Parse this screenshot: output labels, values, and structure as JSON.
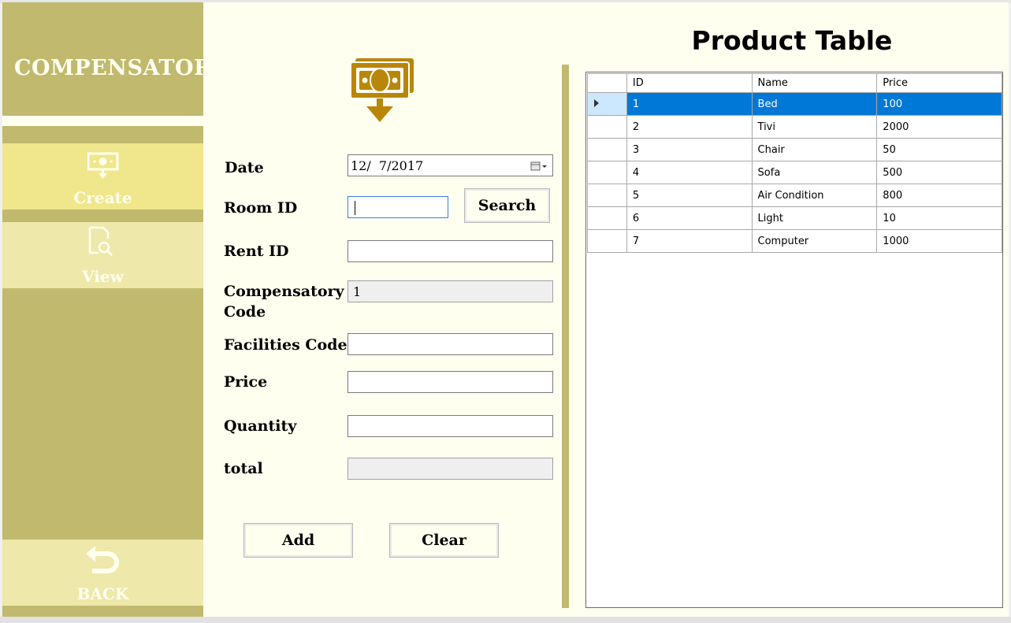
{
  "sidebar": {
    "brand": "COMPENSATORY",
    "items": [
      {
        "label": "Create",
        "icon": "money-icon"
      },
      {
        "label": "View",
        "icon": "document-search-icon"
      }
    ],
    "back": {
      "label": "BACK",
      "icon": "back-arrow-icon"
    }
  },
  "form": {
    "date": {
      "label": "Date",
      "value": "12/  7/2017"
    },
    "room_id": {
      "label": "Room ID",
      "value": ""
    },
    "search_button": "Search",
    "rent_id": {
      "label": "Rent ID",
      "value": ""
    },
    "compensatory_code": {
      "label_line1": "Compensatory",
      "label_line2": "Code",
      "value": "1"
    },
    "facilities_code": {
      "label": "Facilities Code",
      "value": ""
    },
    "price": {
      "label": "Price",
      "value": ""
    },
    "quantity": {
      "label": "Quantity",
      "value": ""
    },
    "total": {
      "label": "total",
      "value": ""
    },
    "add_button": "Add",
    "clear_button": "Clear"
  },
  "product_table": {
    "title": "Product Table",
    "columns": [
      "ID",
      "Name",
      "Price"
    ],
    "rows": [
      {
        "id": "1",
        "name": "Bed",
        "price": "100"
      },
      {
        "id": "2",
        "name": "Tivi",
        "price": "2000"
      },
      {
        "id": "3",
        "name": "Chair",
        "price": "50"
      },
      {
        "id": "4",
        "name": "Sofa",
        "price": "500"
      },
      {
        "id": "5",
        "name": "Air Condition",
        "price": "800"
      },
      {
        "id": "6",
        "name": "Light",
        "price": "10"
      },
      {
        "id": "7",
        "name": "Computer",
        "price": "1000"
      }
    ],
    "selected_row": 0
  },
  "colors": {
    "sidebar": "#c0b96e",
    "nav_active": "#f0e68c",
    "nav_inactive": "#eee8aa",
    "background": "#fffff0",
    "icon_gold": "#b8860b",
    "selection": "#0078d7"
  }
}
